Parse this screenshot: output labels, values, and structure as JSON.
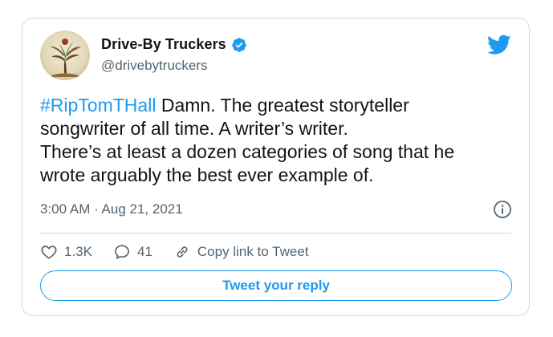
{
  "author": {
    "display_name": "Drive-By Truckers",
    "handle": "@drivebytruckers",
    "verified": true
  },
  "tweet": {
    "hashtag": "#RipTomTHall",
    "line1_rest": " Damn. The greatest storyteller",
    "line2": "songwriter of all time. A writer’s writer.",
    "line3": "There’s at least a dozen categories of song that he",
    "line4": "wrote arguably the best ever example of.",
    "timestamp": "3:00 AM · Aug 21, 2021"
  },
  "actions": {
    "likes": "1.3K",
    "replies": "41",
    "copy_link": "Copy link to Tweet"
  },
  "reply_button": "Tweet your reply",
  "icons": [
    "verified-badge-icon",
    "twitter-bird-icon",
    "info-icon",
    "heart-icon",
    "reply-bubble-icon",
    "link-icon"
  ],
  "colors": {
    "accent": "#1d9bf0",
    "text": "#0f1419",
    "secondary": "#536471",
    "border": "#cfd9de"
  }
}
